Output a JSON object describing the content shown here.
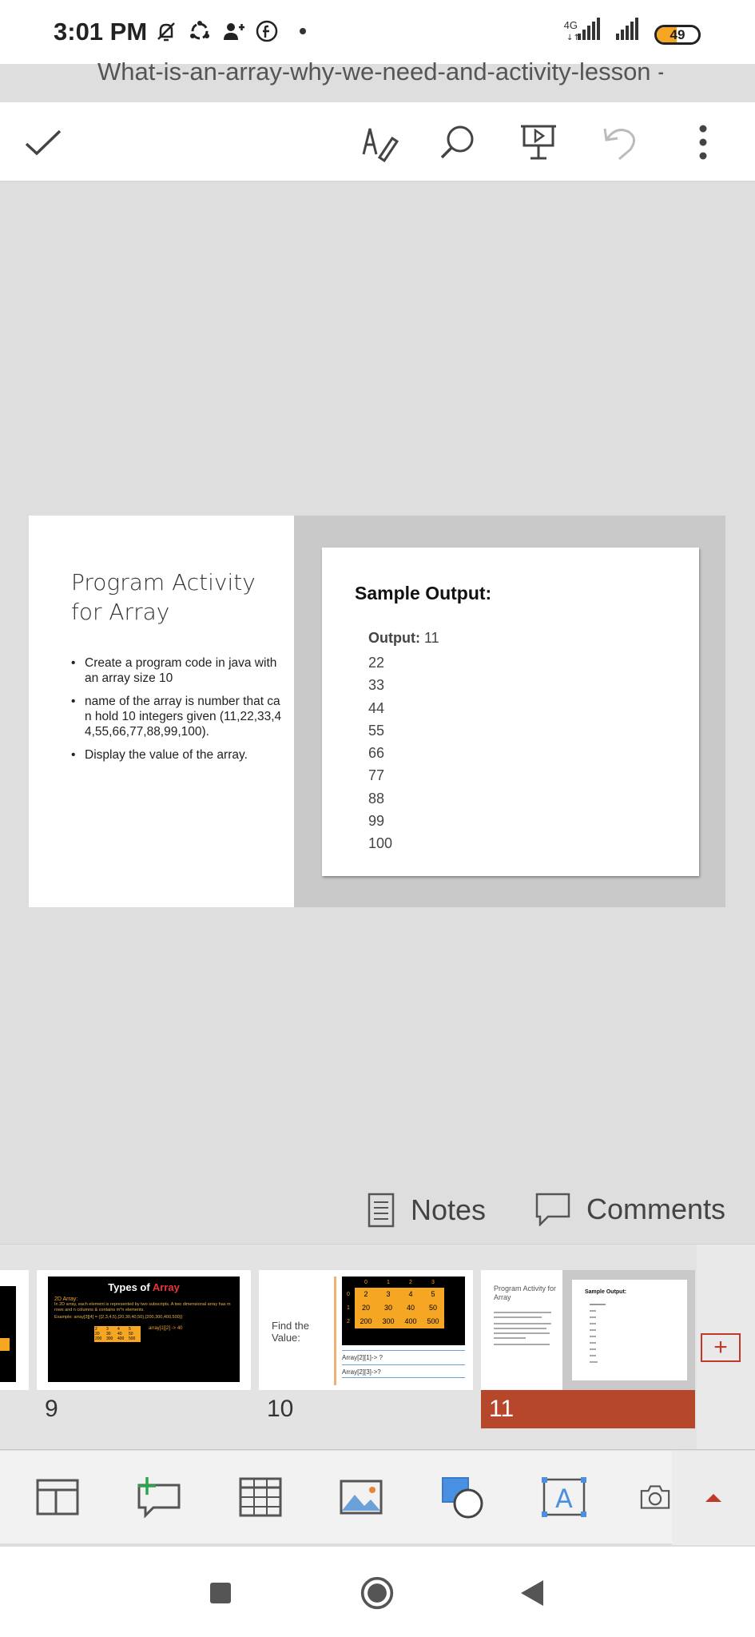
{
  "status_bar": {
    "time": "3:01 PM",
    "network_label": "4G",
    "battery": "49",
    "battery_level": 0.49,
    "icons": [
      "mute-bell-icon",
      "sync-icon",
      "add-user-icon",
      "facebook-icon"
    ]
  },
  "document": {
    "title": "What-is-an-array-why-we-need-and-activity-lesson - S"
  },
  "toolbar": {
    "icons": [
      "checkmark-icon",
      "pen-icon",
      "search-icon",
      "present-icon",
      "undo-icon",
      "more-icon"
    ]
  },
  "slide": {
    "title": "Program Activity for Array",
    "bullets": [
      "Create a program code in java with an array size 10",
      "name of the array is number that can hold 10 integers given (11,22,33,44,55,66,77,88,99,100).",
      "Display the value of the array."
    ],
    "card": {
      "title": "Sample Output:",
      "output_label": "Output:",
      "values": [
        "11",
        "22",
        "33",
        "44",
        "55",
        "66",
        "77",
        "88",
        "99",
        "100"
      ]
    }
  },
  "panels": {
    "notes_label": "Notes",
    "comments_label": "Comments"
  },
  "thumbnails": [
    {
      "number": "9",
      "title_prefix": "Types of ",
      "title_highlight": "Array",
      "heading": "2D Array:",
      "line": "In 2D array, each element is represented by two subscripts. A two dimensional array has m rows and n columns & contains m*n elements.",
      "example": "Example: array[3][4] = {{2,3,4,5},{20,30,40,50},{200,300,400,500}}",
      "result": "array[1][2] -> 40",
      "grid": [
        [
          "2",
          "3",
          "4",
          "5"
        ],
        [
          "20",
          "30",
          "40",
          "50"
        ],
        [
          "200",
          "300",
          "400",
          "500"
        ]
      ]
    },
    {
      "number": "10",
      "label": "Find the Value:",
      "col_headers": [
        "0",
        "1",
        "2",
        "3"
      ],
      "row_headers": [
        "0",
        "1",
        "2"
      ],
      "grid": [
        [
          "2",
          "3",
          "4",
          "5"
        ],
        [
          "20",
          "30",
          "40",
          "50"
        ],
        [
          "200",
          "300",
          "400",
          "500"
        ]
      ],
      "q1": "Array[2][1]-> ?",
      "q2": "Array[2][3]->?"
    },
    {
      "number": "11",
      "title": "Program Activity for Array",
      "card_title": "Sample Output:",
      "active": true
    }
  ],
  "add_slide_label": "+",
  "insert_toolbar": {
    "icons": [
      "layout-icon",
      "new-comment-icon",
      "table-icon",
      "picture-icon",
      "shapes-icon",
      "textbox-icon",
      "camera-icon",
      "collapse-up-icon"
    ]
  },
  "nav_bar": {
    "icons": [
      "recents-square-icon",
      "home-circle-icon",
      "back-triangle-icon"
    ]
  },
  "colors": {
    "accent": "#B7472A",
    "thumb_orange": "#F5A623",
    "slide_bg": "#C9C9C9"
  }
}
